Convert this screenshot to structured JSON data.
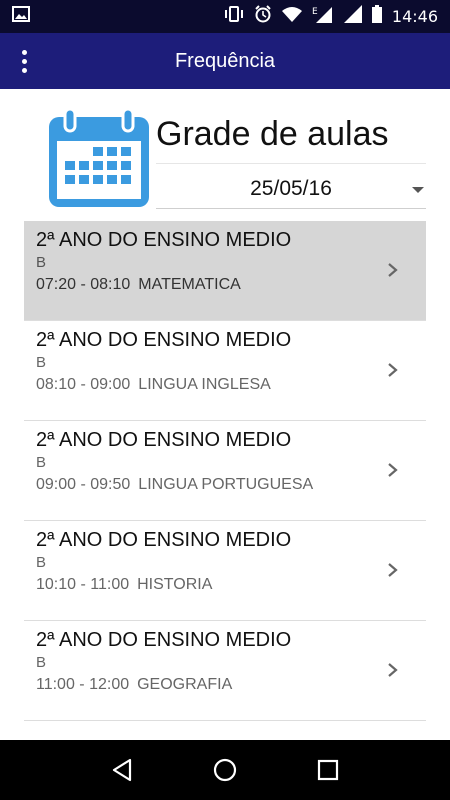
{
  "status_bar": {
    "time": "14:46",
    "icons": [
      "image-icon",
      "vibrate-icon",
      "alarm-icon",
      "wifi-icon",
      "signal-e-icon",
      "signal-icon",
      "battery-icon"
    ]
  },
  "app_bar": {
    "title": "Frequência"
  },
  "header": {
    "title": "Grade de aulas",
    "date": "25/05/16"
  },
  "classes": [
    {
      "class_name": "2ª ANO DO ENSINO MEDIO",
      "group": "B",
      "time": "07:20 - 08:10",
      "subject": "MATEMATICA",
      "selected": true
    },
    {
      "class_name": "2ª ANO DO ENSINO MEDIO",
      "group": "B",
      "time": "08:10 - 09:00",
      "subject": "LINGUA INGLESA",
      "selected": false
    },
    {
      "class_name": "2ª ANO DO ENSINO MEDIO",
      "group": "B",
      "time": "09:00 - 09:50",
      "subject": "LINGUA PORTUGUESA",
      "selected": false
    },
    {
      "class_name": "2ª ANO DO ENSINO MEDIO",
      "group": "B",
      "time": "10:10 - 11:00",
      "subject": "HISTORIA",
      "selected": false
    },
    {
      "class_name": "2ª ANO DO ENSINO MEDIO",
      "group": "B",
      "time": "11:00 - 12:00",
      "subject": "GEOGRAFIA",
      "selected": false
    }
  ],
  "colors": {
    "app_bar": "#1d1d7a",
    "status_bar": "#0b0b2e",
    "calendar_icon": "#3b9be0",
    "selected_row": "#d6d6d6"
  }
}
